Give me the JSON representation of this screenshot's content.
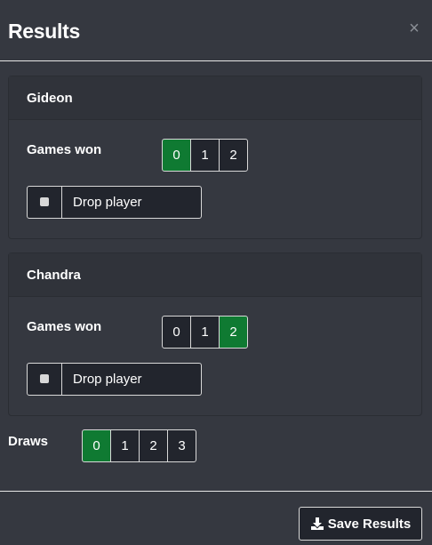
{
  "modal": {
    "title": "Results",
    "close_glyph": "×"
  },
  "players": [
    {
      "name": "Gideon",
      "games_won_label": "Games won",
      "games_won_options": [
        "0",
        "1",
        "2"
      ],
      "games_won_selected": "0",
      "drop_label": "Drop player",
      "drop_checked": false
    },
    {
      "name": "Chandra",
      "games_won_label": "Games won",
      "games_won_options": [
        "0",
        "1",
        "2"
      ],
      "games_won_selected": "2",
      "drop_label": "Drop player",
      "drop_checked": false
    }
  ],
  "draws": {
    "label": "Draws",
    "options": [
      "0",
      "1",
      "2",
      "3"
    ],
    "selected": "0"
  },
  "footer": {
    "save_label": "Save Results",
    "save_icon": "download-icon"
  },
  "colors": {
    "background": "#353840",
    "button_bg": "#22252d",
    "active_green": "#0f7a32",
    "border": "#d8d8d8"
  }
}
